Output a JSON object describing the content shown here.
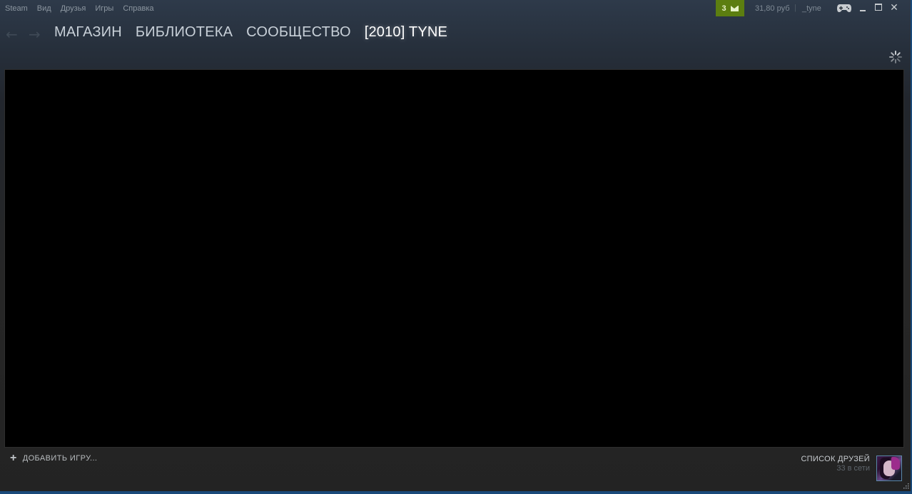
{
  "menu": {
    "items": [
      "Steam",
      "Вид",
      "Друзья",
      "Игры",
      "Справка"
    ]
  },
  "notifications": {
    "count": "3",
    "icon": "envelope-icon",
    "color": "#5c7e10"
  },
  "account": {
    "wallet": "31,80 руб",
    "separator": "|",
    "username": "_tyne"
  },
  "window_controls": {
    "close": "✕"
  },
  "nav": {
    "back_icon": "←",
    "forward_icon": "→",
    "links": [
      "МАГАЗИН",
      "БИБЛИОТЕКА",
      "СООБЩЕСТВО",
      "[2010] TYNE"
    ],
    "active_index": 3
  },
  "footer": {
    "add_game_icon": "+",
    "add_game_label": "ДОБАВИТЬ ИГРУ...",
    "friends_title": "СПИСОК ДРУЗЕЙ",
    "friends_online": "33 в сети"
  },
  "colors": {
    "background": "#1b2838",
    "content": "#000000",
    "accent_green": "#5c7e10",
    "taskbar": "#1a4a7a"
  }
}
